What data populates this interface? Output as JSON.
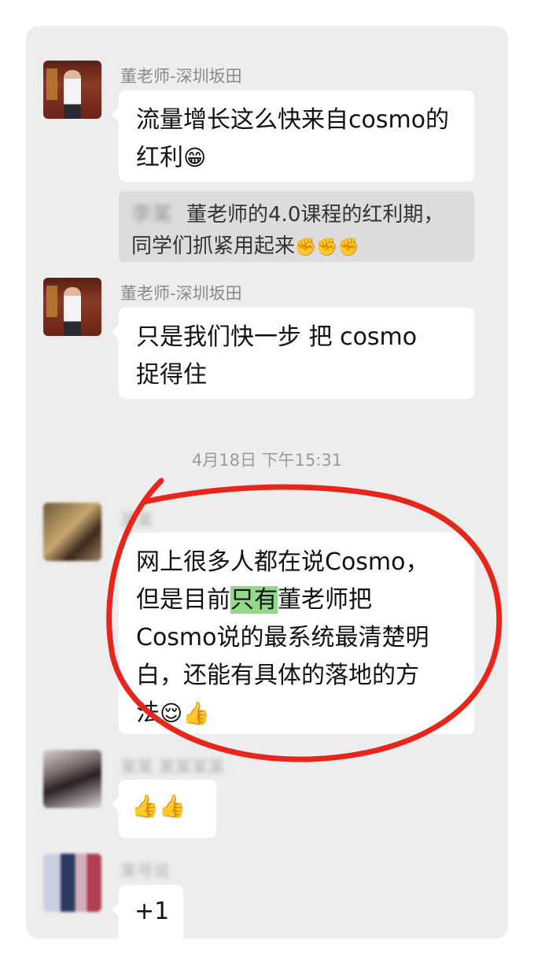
{
  "messages": [
    {
      "sender": "董老师-深圳坂田",
      "text": "流量增长这么快来自cosmo的红利",
      "emoji": "😁"
    },
    {
      "quote_sender": "李某",
      "quote_text": "董老师的4.0课程的红利期，同学们抓紧用起来",
      "quote_emoji": "✊✊✊"
    },
    {
      "sender": "董老师-深圳坂田",
      "text_line1": "只是我们快一步 把 cosmo",
      "text_line2": "捉得住"
    },
    {
      "timestamp": "4月18日 下午15:31"
    },
    {
      "sender": "某某",
      "line1": "网上很多人都在说Cosmo，",
      "line2_a": "但是目前",
      "line2_hl": "只有",
      "line2_b": "董老师把",
      "line3": "Cosmo说的最系统最清楚明",
      "line4": "白，还能有具体的落地的方",
      "line5": "法",
      "emoji": "😌👍"
    },
    {
      "sender": "某某 某某某某",
      "emoji": "👍👍"
    },
    {
      "sender": "某号说",
      "text": "+1"
    }
  ],
  "colors": {
    "highlight": "#92d98a",
    "circle": "#e8251a",
    "bubble": "#ffffff",
    "background": "#ededed"
  }
}
